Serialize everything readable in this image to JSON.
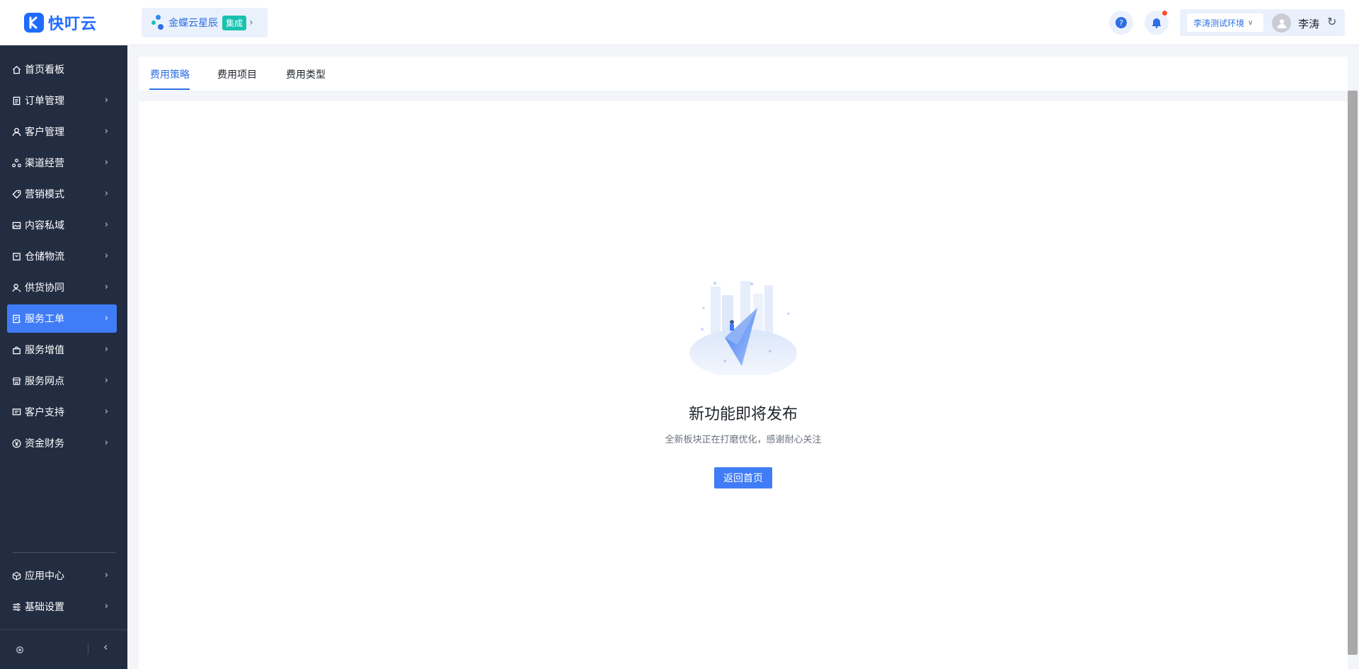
{
  "app": {
    "name": "快叮云"
  },
  "brand": {
    "name": "金蝶云星辰",
    "tag": "集成"
  },
  "header": {
    "environment": "李涛测试环境",
    "user_name": "李涛"
  },
  "sidebar": {
    "items": [
      {
        "label": "首页看板",
        "icon": "home-icon",
        "has_children": false,
        "active": false
      },
      {
        "label": "订单管理",
        "icon": "clipboard-icon",
        "has_children": true,
        "active": false
      },
      {
        "label": "客户管理",
        "icon": "user-icon",
        "has_children": true,
        "active": false
      },
      {
        "label": "渠道经营",
        "icon": "network-icon",
        "has_children": true,
        "active": false
      },
      {
        "label": "营销模式",
        "icon": "tag-icon",
        "has_children": true,
        "active": false
      },
      {
        "label": "内容私域",
        "icon": "image-icon",
        "has_children": true,
        "active": false
      },
      {
        "label": "仓储物流",
        "icon": "box-icon",
        "has_children": true,
        "active": false
      },
      {
        "label": "供货协同",
        "icon": "user-link-icon",
        "has_children": true,
        "active": false
      },
      {
        "label": "服务工单",
        "icon": "ticket-icon",
        "has_children": true,
        "active": true
      },
      {
        "label": "服务增值",
        "icon": "bag-icon",
        "has_children": true,
        "active": false
      },
      {
        "label": "服务网点",
        "icon": "store-icon",
        "has_children": true,
        "active": false
      },
      {
        "label": "客户支持",
        "icon": "message-icon",
        "has_children": true,
        "active": false
      },
      {
        "label": "资金财务",
        "icon": "yen-icon",
        "has_children": true,
        "active": false
      }
    ],
    "bottom_items": [
      {
        "label": "应用中心",
        "icon": "cube-icon",
        "has_children": true
      },
      {
        "label": "基础设置",
        "icon": "sliders-icon",
        "has_children": true
      }
    ]
  },
  "tabs": [
    {
      "label": "费用策略",
      "active": true
    },
    {
      "label": "费用项目",
      "active": false
    },
    {
      "label": "费用类型",
      "active": false
    }
  ],
  "empty_state": {
    "title": "新功能即将发布",
    "subtitle": "全新板块正在打磨优化，感谢耐心关注",
    "button": "返回首页"
  },
  "colors": {
    "primary": "#3f7cf6",
    "sidebar_bg": "#232d42",
    "brand_tag": "#19c2b0",
    "notification": "#ff4d2e"
  }
}
